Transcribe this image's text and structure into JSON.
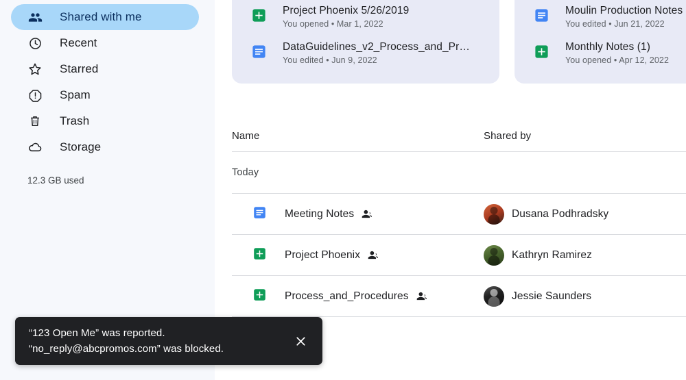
{
  "sidebar": {
    "items": [
      {
        "label": "Shared with me",
        "icon": "people-icon",
        "active": true
      },
      {
        "label": "Recent",
        "icon": "clock-icon",
        "active": false
      },
      {
        "label": "Starred",
        "icon": "star-icon",
        "active": false
      },
      {
        "label": "Spam",
        "icon": "warning-octagon-icon",
        "active": false
      },
      {
        "label": "Trash",
        "icon": "trash-icon",
        "active": false
      },
      {
        "label": "Storage",
        "icon": "cloud-icon",
        "active": false
      }
    ],
    "storage_used": "12.3 GB used"
  },
  "cards": [
    {
      "rows": [
        {
          "icon": "sheets-icon",
          "title": "Project Phoenix 5/26/2019",
          "subtitle": "You opened • Mar 1, 2022"
        },
        {
          "icon": "docs-icon",
          "title": "DataGuidelines_v2_Process_and_Pr…",
          "subtitle": "You edited • Jun 9, 2022"
        }
      ]
    },
    {
      "rows": [
        {
          "icon": "docs-icon",
          "title": "Moulin Production Notes",
          "subtitle": "You edited • Jun 21, 2022"
        },
        {
          "icon": "sheets-icon",
          "title": "Monthly Notes (1)",
          "subtitle": "You opened • Apr 12, 2022"
        }
      ]
    }
  ],
  "table": {
    "columns": {
      "name": "Name",
      "shared_by": "Shared by"
    },
    "group_label": "Today",
    "rows": [
      {
        "icon": "docs-icon",
        "name": "Meeting Notes",
        "shared_glyph": "shared-people-icon",
        "shared_by": "Dusana Podhradsky",
        "avatar_color": "#c0502a"
      },
      {
        "icon": "sheets-icon",
        "name": "Project Phoenix",
        "shared_glyph": "shared-people-icon",
        "shared_by": "Kathryn Ramirez",
        "avatar_color": "#5d7a3c"
      },
      {
        "icon": "sheets-icon",
        "name": "Process_and_Procedures",
        "shared_glyph": "shared-people-icon",
        "shared_by": "Jessie Saunders",
        "avatar_color": "#1b1b1b"
      }
    ]
  },
  "toast": {
    "line1": "“123 Open Me” was reported.",
    "line2": "“no_reply@abcpromos.com” was blocked.",
    "close_icon": "close-icon"
  },
  "colors": {
    "sidebar_bg": "#f6f8fc",
    "active_pill": "#a8d7f9",
    "card_bg": "#e8eaf6",
    "docs_blue": "#4285f4",
    "sheets_green": "#0f9d58",
    "toast_bg": "#202124",
    "divider": "#dadce0"
  }
}
